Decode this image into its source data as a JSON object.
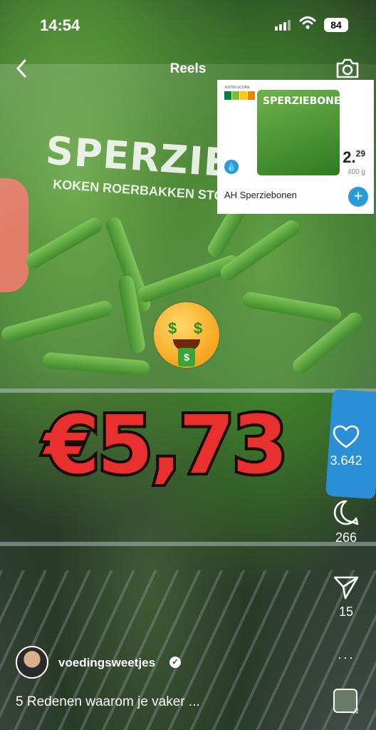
{
  "status_bar": {
    "time": "14:54",
    "battery": "84"
  },
  "header": {
    "back_icon": "chevron-left-icon",
    "title": "Reels",
    "camera_icon": "camera-icon"
  },
  "video": {
    "bag_text": "SPERZIEB",
    "bag_subtext": "KOKEN  ROERBAKKEN  STOMEN",
    "overlay_price": "€5,73",
    "emoji": "money-mouth-face"
  },
  "product_card": {
    "nutri_label": "NUTRI-SCORE",
    "thumb_label": "SPERZIEBONEN",
    "price_main": "2.",
    "price_cents": "29",
    "weight": "400 g",
    "name": "AH Sperziebonen",
    "add_label": "+"
  },
  "actions": {
    "likes": "3.642",
    "comments": "266",
    "shares": "15",
    "more": "···"
  },
  "author": {
    "username": "voedingsweetjes",
    "verified_mark": "✓"
  },
  "caption": "5 Redenen waarom je vaker ...",
  "colors": {
    "price_red": "#e8312e",
    "ah_blue": "#2a9ad8",
    "nutri_a": "#038141",
    "nutri_b": "#85bb2f",
    "nutri_c": "#fecb02",
    "nutri_d": "#ee8100",
    "nutri_e": "#e63e11"
  }
}
